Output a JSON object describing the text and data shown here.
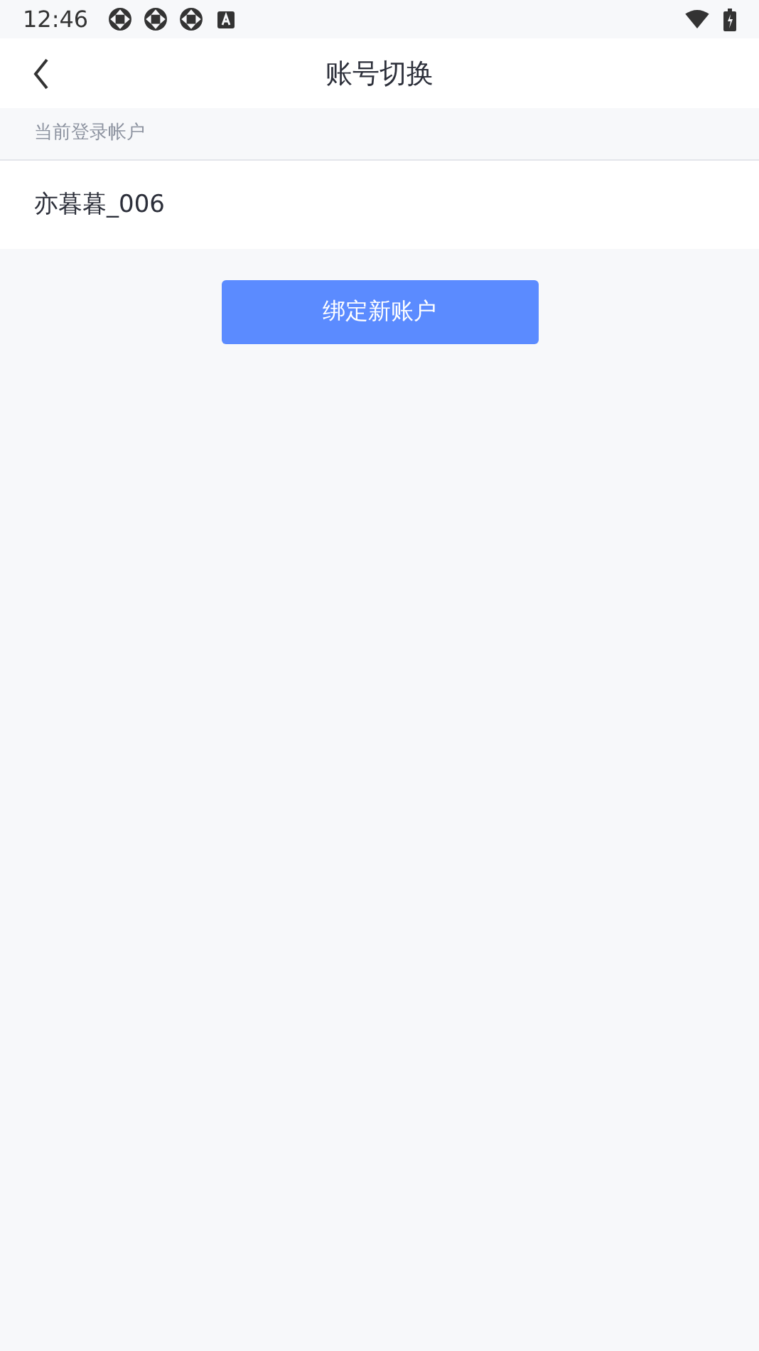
{
  "status_bar": {
    "time": "12:46"
  },
  "header": {
    "title": "账号切换"
  },
  "section": {
    "label": "当前登录帐户"
  },
  "accounts": [
    {
      "name": "亦暮暮_006"
    }
  ],
  "bind_button": {
    "label": "绑定新账户"
  }
}
